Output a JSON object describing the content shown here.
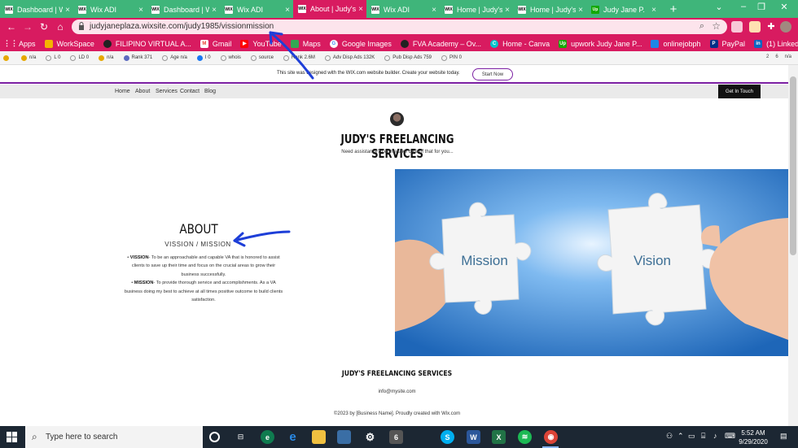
{
  "browser": {
    "tabs": [
      {
        "label": "Dashboard | W",
        "favicon": "WIX",
        "active": false
      },
      {
        "label": "Wix ADI",
        "favicon": "WIX",
        "active": false
      },
      {
        "label": "Dashboard | W",
        "favicon": "WIX",
        "active": false
      },
      {
        "label": "Wix ADI",
        "favicon": "WIX",
        "active": false
      },
      {
        "label": "About | Judy's",
        "favicon": "WIX",
        "active": true
      },
      {
        "label": "Wix ADI",
        "favicon": "WIX",
        "active": false
      },
      {
        "label": "Home | Judy's",
        "favicon": "WIX",
        "active": false
      },
      {
        "label": "Home | Judy's",
        "favicon": "WIX",
        "active": false
      },
      {
        "label": "Judy Jane P.",
        "favicon": "Up",
        "active": false
      }
    ],
    "url": "judyjaneplaza.wixsite.com/judy1985/vissionmission",
    "bookmarks": [
      {
        "label": "Apps",
        "icon": "apps-grid-icon",
        "color": "#ffffff"
      },
      {
        "label": "WorkSpace",
        "icon": "workspace-icon",
        "color": "#f4b400"
      },
      {
        "label": "FILIPINO VIRTUAL A...",
        "icon": "filipino-va-icon",
        "color": "#222222"
      },
      {
        "label": "Gmail",
        "icon": "gmail-icon",
        "color": "#ea4335"
      },
      {
        "label": "YouTube",
        "icon": "youtube-icon",
        "color": "#ff0000"
      },
      {
        "label": "Maps",
        "icon": "maps-icon",
        "color": "#34a853"
      },
      {
        "label": "Google Images",
        "icon": "google-icon",
        "color": "#4285f4"
      },
      {
        "label": "FVA Academy – Ov...",
        "icon": "fva-icon",
        "color": "#222222"
      },
      {
        "label": "Home - Canva",
        "icon": "canva-icon",
        "color": "#00c4cc"
      },
      {
        "label": "upwork Judy Jane P...",
        "icon": "upwork-icon",
        "color": "#14a800"
      },
      {
        "label": "onlinejobph",
        "icon": "onlinejobs-icon",
        "color": "#1e88e5"
      },
      {
        "label": "PayPal",
        "icon": "paypal-icon",
        "color": "#003087"
      },
      {
        "label": "(1) LinkedIn",
        "icon": "linkedin-icon",
        "color": "#0a66c2"
      }
    ],
    "seo": [
      {
        "label": "n/a",
        "color": "#e6a800"
      },
      {
        "label": "L 0",
        "color": "#999999"
      },
      {
        "label": "LD 0",
        "color": "#999999"
      },
      {
        "label": "n/a",
        "color": "#e6a800"
      },
      {
        "label": "Rank 371",
        "color": "#5c6bc0"
      },
      {
        "label": "Age n/a",
        "color": "#999999"
      },
      {
        "label": "I 0",
        "color": "#1877f2"
      },
      {
        "label": "whois",
        "color": "#999999"
      },
      {
        "label": "source",
        "color": "#999999"
      },
      {
        "label": "Rank 2.6M",
        "color": "#999999"
      },
      {
        "label": "Adv Disp Ads 132K",
        "color": "#999999"
      },
      {
        "label": "Pub Disp Ads 759",
        "color": "#999999"
      },
      {
        "label": "PIN 0",
        "color": "#999999"
      }
    ],
    "seo_right": [
      "2",
      "6",
      "n/a"
    ]
  },
  "wix_banner": {
    "text": "This site was designed with the WIX.com website builder. Create your website today.",
    "button": "Start Now"
  },
  "site": {
    "nav": [
      "Home",
      "About",
      "Services",
      "Contact",
      "Blog"
    ],
    "cta": "Get In Touch",
    "title": "JUDY'S FREELANCING SERVICES",
    "tagline": "Need assistance? Let me take care of that for you...",
    "about_heading": "ABOUT",
    "about_sub": "VISSION / MISSION",
    "vision_label": "VISSION",
    "vision_text": "- To be an approachable and capable VA that is honored to assist clients to save up their time and focus on the crucial areas to grow their business successfully.",
    "mission_label": "MISSION",
    "mission_text": "- To provide thorough service and accomplishments. As a VA business doing my best to achieve at all times positive outcome to build clients satisfaction.",
    "photo_left": "Mission",
    "photo_right": "Vision",
    "footer_title": "JUDY'S FREELANCING SERVICES",
    "footer_email": "info@mysite.com",
    "footer_copy": "©2023 by [Business Name]. Proudly created with Wix.com"
  },
  "taskbar": {
    "search_placeholder": "Type here to search",
    "time": "5:52 AM",
    "date": "9/29/2020"
  },
  "colors": {
    "tab_strip": "#3fb57a",
    "toolbar": "#d81b60",
    "annotation_arrow": "#1e3fd8",
    "photo_sky": "#2f7fd0"
  }
}
